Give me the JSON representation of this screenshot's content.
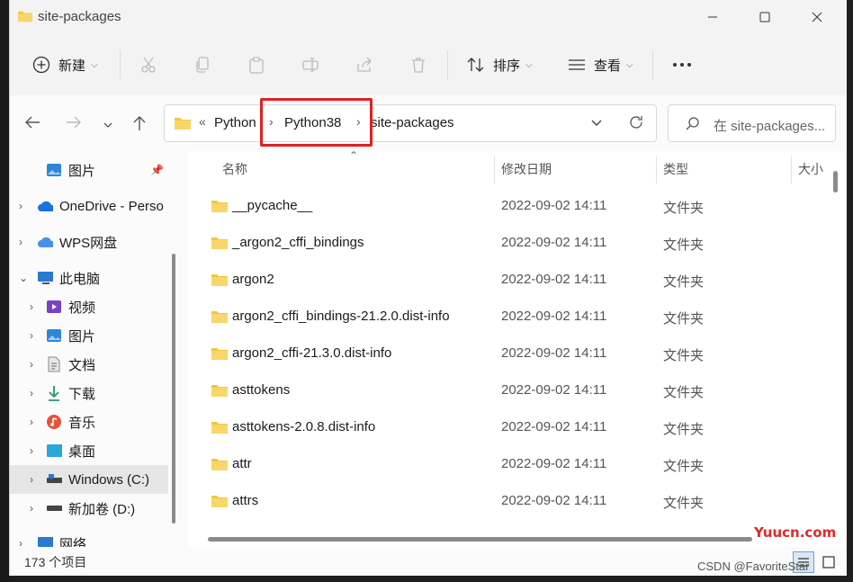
{
  "window": {
    "title": "site-packages"
  },
  "toolbar": {
    "new_label": "新建",
    "sort_label": "排序",
    "view_label": "查看"
  },
  "address": {
    "crumbs": [
      "Python",
      "Python38",
      "site-packages"
    ],
    "prefix": "«"
  },
  "search": {
    "placeholder": "在 site-packages..."
  },
  "sidebar": {
    "items": [
      {
        "label": "图片",
        "icon": "pictures-icon"
      },
      {
        "label": "OneDrive - Perso",
        "icon": "onedrive-icon"
      },
      {
        "label": "WPS网盘",
        "icon": "wps-cloud-icon"
      },
      {
        "label": "此电脑",
        "icon": "this-pc-icon"
      },
      {
        "label": "视频",
        "icon": "videos-icon"
      },
      {
        "label": "图片",
        "icon": "pictures-icon"
      },
      {
        "label": "文档",
        "icon": "documents-icon"
      },
      {
        "label": "下载",
        "icon": "downloads-icon"
      },
      {
        "label": "音乐",
        "icon": "music-icon"
      },
      {
        "label": "桌面",
        "icon": "desktop-icon"
      },
      {
        "label": "Windows (C:)",
        "icon": "drive-c-icon"
      },
      {
        "label": "新加卷 (D:)",
        "icon": "drive-d-icon"
      },
      {
        "label": "网络",
        "icon": "network-icon"
      }
    ]
  },
  "columns": {
    "name": "名称",
    "date": "修改日期",
    "type": "类型",
    "size": "大小"
  },
  "files": [
    {
      "name": "__pycache__",
      "date": "2022-09-02 14:11",
      "type": "文件夹"
    },
    {
      "name": "_argon2_cffi_bindings",
      "date": "2022-09-02 14:11",
      "type": "文件夹"
    },
    {
      "name": "argon2",
      "date": "2022-09-02 14:11",
      "type": "文件夹"
    },
    {
      "name": "argon2_cffi_bindings-21.2.0.dist-info",
      "date": "2022-09-02 14:11",
      "type": "文件夹"
    },
    {
      "name": "argon2_cffi-21.3.0.dist-info",
      "date": "2022-09-02 14:11",
      "type": "文件夹"
    },
    {
      "name": "asttokens",
      "date": "2022-09-02 14:11",
      "type": "文件夹"
    },
    {
      "name": "asttokens-2.0.8.dist-info",
      "date": "2022-09-02 14:11",
      "type": "文件夹"
    },
    {
      "name": "attr",
      "date": "2022-09-02 14:11",
      "type": "文件夹"
    },
    {
      "name": "attrs",
      "date": "2022-09-02 14:11",
      "type": "文件夹"
    }
  ],
  "status": {
    "count": "173 个项目"
  },
  "watermarks": {
    "site": "Yuucn.com",
    "csdn": "CSDN @FavoriteStar"
  },
  "colors": {
    "folder": "#f4c542",
    "highlight": "#e02020",
    "selected": "#e6e6e6"
  }
}
